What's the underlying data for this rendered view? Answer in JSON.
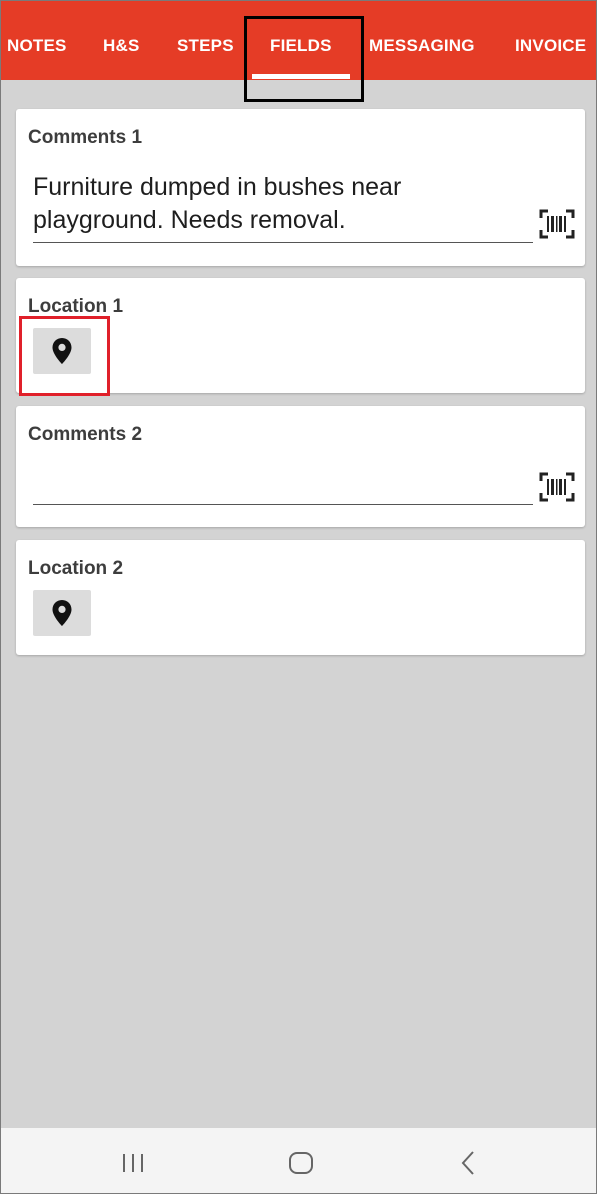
{
  "tabs": [
    {
      "label": "NOTES"
    },
    {
      "label": "H&S"
    },
    {
      "label": "STEPS"
    },
    {
      "label": "FIELDS",
      "active": true
    },
    {
      "label": "MESSAGING"
    },
    {
      "label": "INVOICE"
    }
  ],
  "fields": {
    "comments1": {
      "label": "Comments 1",
      "value": "Furniture dumped in bushes near playground. Needs removal."
    },
    "location1": {
      "label": "Location 1"
    },
    "comments2": {
      "label": "Comments 2",
      "value": ""
    },
    "location2": {
      "label": "Location 2"
    }
  },
  "icons": {
    "barcode": "barcode-scan-icon",
    "location": "map-marker-icon",
    "nav_recent": "recent-apps-icon",
    "nav_home": "home-icon",
    "nav_back": "back-icon"
  },
  "colors": {
    "tab_bar": "#e53c26",
    "background": "#d3d3d3",
    "card": "#ffffff",
    "location_button": "#dcdcdc",
    "annotation_red": "#e0202a",
    "annotation_black": "#000000"
  }
}
